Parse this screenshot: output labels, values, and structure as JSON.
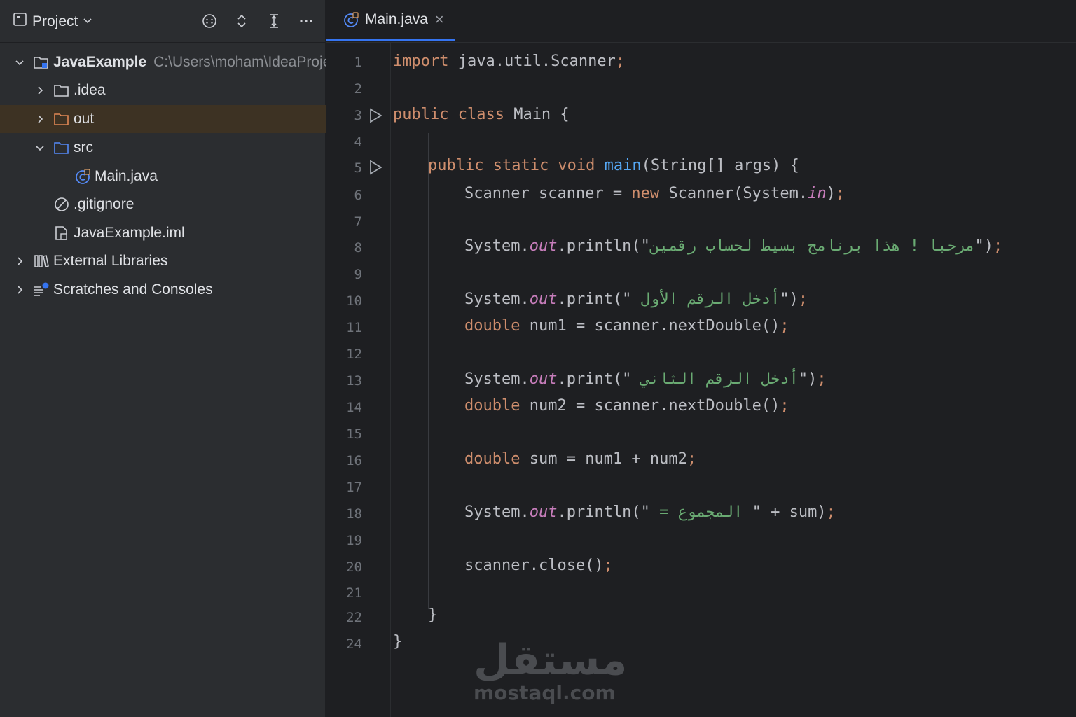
{
  "sidebar": {
    "title": "Project",
    "tree": [
      {
        "label": "JavaExample",
        "path": "C:\\Users\\moham\\IdeaProje"
      },
      {
        "label": ".idea"
      },
      {
        "label": "out"
      },
      {
        "label": "src"
      },
      {
        "label": "Main.java"
      },
      {
        "label": ".gitignore"
      },
      {
        "label": "JavaExample.iml"
      },
      {
        "label": "External Libraries"
      },
      {
        "label": "Scratches and Consoles"
      }
    ]
  },
  "editor": {
    "tab": {
      "label": "Main.java",
      "close": "×"
    },
    "line_numbers": [
      "1",
      "2",
      "3",
      "4",
      "5",
      "6",
      "7",
      "8",
      "9",
      "10",
      "11",
      "12",
      "13",
      "14",
      "15",
      "16",
      "17",
      "18",
      "19",
      "20",
      "21",
      "22",
      "24"
    ]
  },
  "code": {
    "l1": {
      "kw": "import",
      "rest": " java.util.Scanner",
      "semi": ";"
    },
    "l3": {
      "kw": "public class",
      "rest": " Main {"
    },
    "l5": {
      "kw": "public static void",
      "fn": "main",
      "rest": "(String[] args) {"
    },
    "l6": {
      "a": "Scanner scanner = ",
      "kw": "new",
      "b": " Scanner(System.",
      "it": "in",
      "c": ")",
      "semi": ";"
    },
    "l8": {
      "a": "System.",
      "it": "out",
      "b": ".println(\"",
      "str": "مرحبا ! هذا برنامج بسيط لحساب رقمين",
      "c": "\")",
      "semi": ";"
    },
    "l10": {
      "a": "System.",
      "it": "out",
      "b": ".print(\"",
      "str": "أدخل الرقم الأول ",
      "c": "\")",
      "semi": ";"
    },
    "l11": {
      "kw": "double",
      "a": " num1 = scanner.nextDouble()",
      "semi": ";"
    },
    "l13": {
      "a": "System.",
      "it": "out",
      "b": ".print(\"",
      "str": "أدخل الرقم الثاني ",
      "c": "\")",
      "semi": ";"
    },
    "l14": {
      "kw": "double",
      "a": " num2 = scanner.nextDouble()",
      "semi": ";"
    },
    "l16": {
      "kw": "double",
      "a": " sum = num1 + num2",
      "semi": ";"
    },
    "l18": {
      "a": "System.",
      "it": "out",
      "b": ".println(\"",
      "str": " المجموع = ",
      "c": "\" + sum)",
      "semi": ";"
    },
    "l20": {
      "a": "scanner.close()",
      "semi": ";"
    },
    "l22": {
      "a": "}"
    },
    "l24": {
      "a": "}"
    }
  },
  "watermark": {
    "arabic": "مستقل",
    "latin": "mostaql.com"
  },
  "colors": {
    "keyword": "#cf8e6d",
    "function": "#56a8f5",
    "string": "#6aab73",
    "selection": "#3d3223",
    "accent": "#3574f0"
  }
}
